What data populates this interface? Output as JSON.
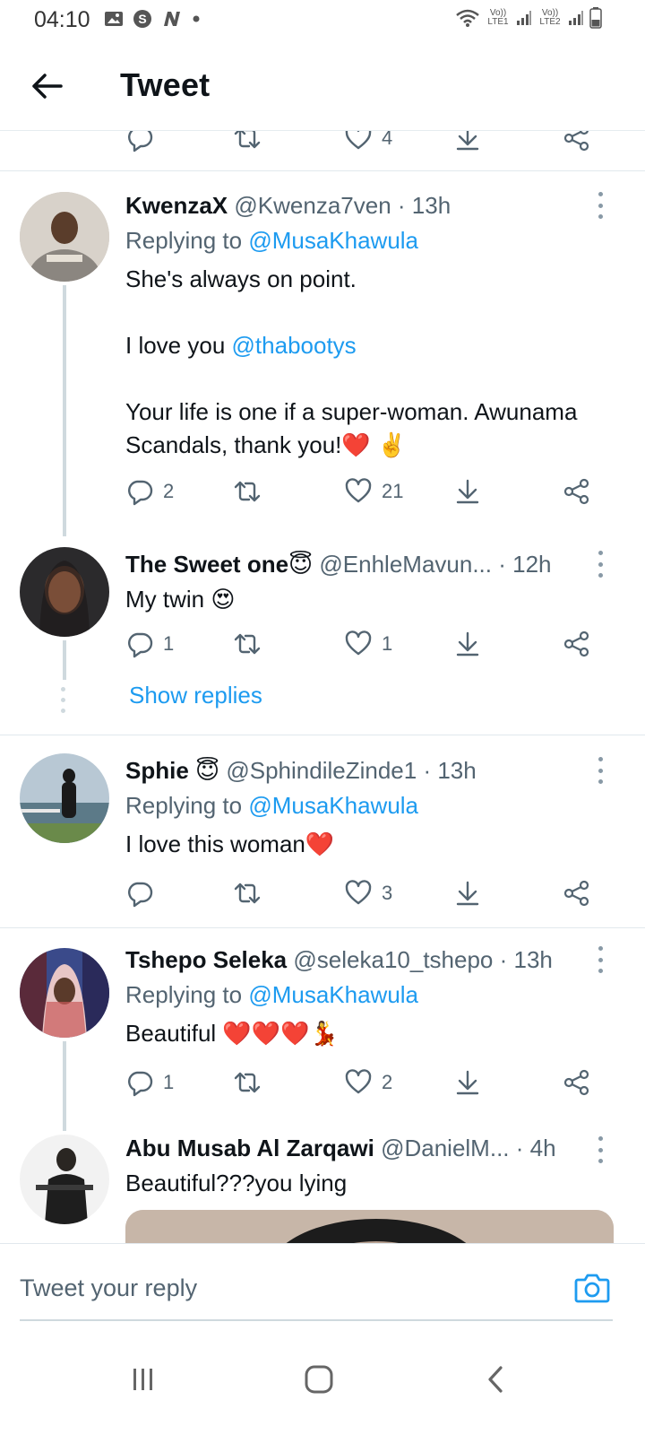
{
  "status_bar": {
    "time": "04:10",
    "sim1_label": "Vo)) LTE1",
    "sim2_label": "Vo)) LTE2"
  },
  "header": {
    "title": "Tweet"
  },
  "top_partial_actions": {
    "like_count": "4"
  },
  "tweets": [
    {
      "name": "KwenzaX",
      "handle": "@Kwenza7ven",
      "time": "· 13h",
      "replying_prefix": "Replying to",
      "replying_to": "@MusaKhawula",
      "text_line1": "She's always on point.",
      "text_line2_prefix": "I love you",
      "text_line2_mention": "@thabootys",
      "text_line3": "Your life is one if a super-woman. Awunama Scandals, thank you!❤️ ✌️",
      "reply_count": "2",
      "retweet_count": "",
      "like_count": "21"
    },
    {
      "name": "The Sweet one😇",
      "handle": "@EnhleMavun...",
      "time": "· 12h",
      "text": "My twin 😍",
      "reply_count": "1",
      "retweet_count": "",
      "like_count": "1",
      "show_replies": "Show replies"
    },
    {
      "name": "Sphie 😇",
      "handle": "@SphindileZinde1",
      "time": "· 13h",
      "replying_prefix": "Replying to",
      "replying_to": "@MusaKhawula",
      "text": "I love this woman❤️",
      "reply_count": "",
      "retweet_count": "",
      "like_count": "3"
    },
    {
      "name": "Tshepo Seleka",
      "handle": "@seleka10_tshepo",
      "time": "· 13h",
      "replying_prefix": "Replying to",
      "replying_to": "@MusaKhawula",
      "text": "Beautiful ❤️❤️❤️💃",
      "reply_count": "1",
      "retweet_count": "",
      "like_count": "2"
    },
    {
      "name": "Abu Musab Al Zarqawi",
      "handle": "@DanielM...",
      "time": "· 4h",
      "text": "Beautiful???you lying"
    }
  ],
  "reply_bar": {
    "placeholder": "Tweet your reply"
  },
  "colors": {
    "accent": "#1d9bf0",
    "secondary_text": "#536471",
    "thread_line": "#cfd9de"
  }
}
